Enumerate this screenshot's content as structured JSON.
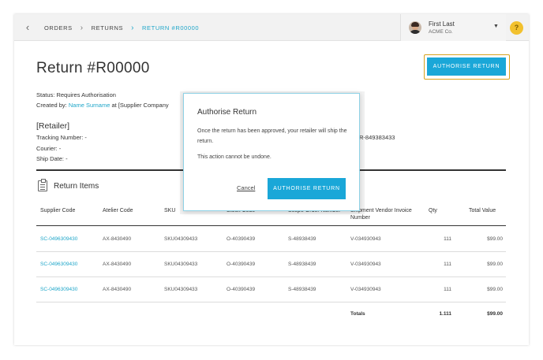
{
  "breadcrumbs": [
    "ORDERS",
    "RETURNS",
    "RETURN #R00000"
  ],
  "user": {
    "name": "First Last",
    "company": "ACME Co."
  },
  "help_label": "?",
  "page": {
    "title": "Return #R00000",
    "authorise_button": "AUTHORISE RETURN",
    "status_label": "Status:",
    "status_value": "Requires Authorisation",
    "created_label": "Created by:",
    "created_name": "Name Surname",
    "created_suffix": "at [Supplier Company",
    "retailer_heading": "[Retailer]",
    "tracking_label": "Tracking Number:",
    "tracking_value": "-",
    "courier_label": "Courier:",
    "courier_value": "-",
    "ship_label": "Ship Date:",
    "ship_value": "-",
    "right_value": "R-849383433"
  },
  "items": {
    "title": "Return Items",
    "columns": [
      "Supplier Code",
      "Atelier Code",
      "SKU",
      "Stock Code",
      "Scope Order Number",
      "Shipment Vendor Invoice Number",
      "Qty",
      "Total Value"
    ],
    "rows": [
      [
        "SC-0496309430",
        "AX-8430490",
        "SKU04309433",
        "O-40390439",
        "S-48938439",
        "V-034930943",
        "111",
        "$99.00"
      ],
      [
        "SC-0496309430",
        "AX-8430490",
        "SKU04309433",
        "O-40390439",
        "S-48938439",
        "V-034930943",
        "111",
        "$99.00"
      ],
      [
        "SC-0496309430",
        "AX-8430490",
        "SKU04309433",
        "O-40390439",
        "S-48938439",
        "V-034930943",
        "111",
        "$99.00"
      ]
    ],
    "totals_label": "Totals",
    "totals_qty": "1.111",
    "totals_value": "$99.00"
  },
  "modal": {
    "title": "Authorise Return",
    "body": "Once the return has been approved, your retailer will ship the return.",
    "warning": "This action cannot be undone.",
    "cancel": "Cancel",
    "confirm": "AUTHORISE RETURN"
  },
  "colors": {
    "accent": "#1aa7d8",
    "focus_ring": "#d6a21e",
    "help": "#f2c12e"
  }
}
